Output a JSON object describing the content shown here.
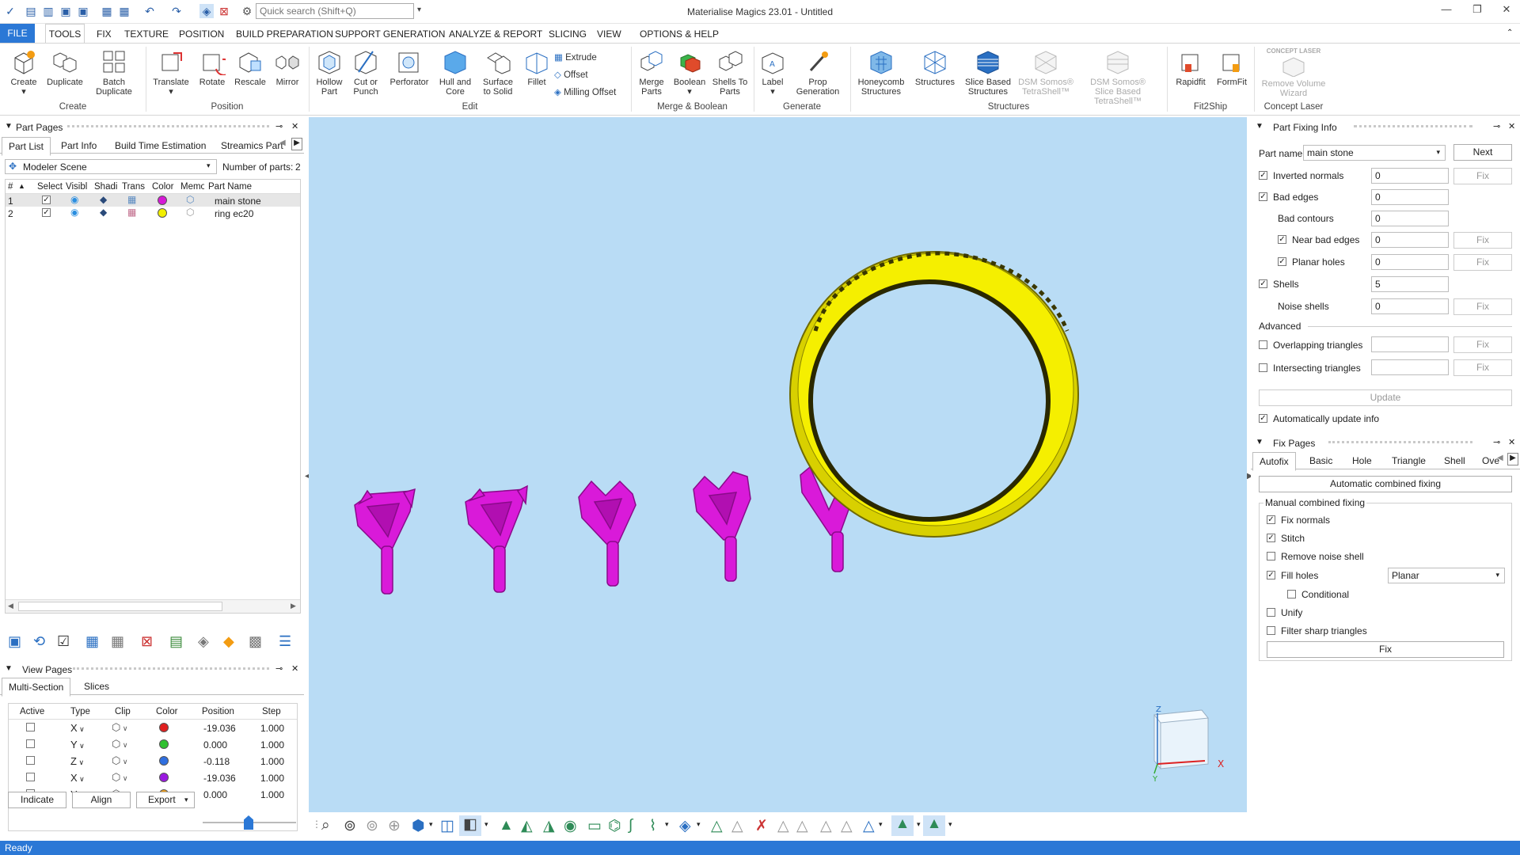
{
  "window": {
    "title": "Materialise Magics 23.01 - Untitled",
    "search_placeholder": "Quick search (Shift+Q)"
  },
  "menu": [
    "FILE",
    "TOOLS",
    "FIX",
    "TEXTURE",
    "POSITION",
    "BUILD PREPARATION",
    "SUPPORT GENERATION",
    "ANALYZE & REPORT",
    "SLICING",
    "VIEW",
    "OPTIONS & HELP"
  ],
  "ribbon": {
    "create": [
      "Create",
      "Duplicate",
      "Batch Duplicate"
    ],
    "create_group": "Create",
    "position": [
      "Translate",
      "Rotate",
      "Rescale",
      "Mirror"
    ],
    "position_group": "Position",
    "edit": [
      "Hollow Part",
      "Cut or Punch",
      "Perforator",
      "Hull and Core",
      "Surface to Solid",
      "Fillet"
    ],
    "edit_small": [
      "Extrude",
      "Offset",
      "Milling Offset"
    ],
    "edit_group": "Edit",
    "merge": [
      "Merge Parts",
      "Boolean",
      "Shells To Parts"
    ],
    "merge_group": "Merge & Boolean",
    "generate": [
      "Label",
      "Prop Generation"
    ],
    "generate_group": "Generate",
    "structures": [
      "Honeycomb Structures",
      "Structures",
      "Slice Based Structures",
      "DSM Somos® TetraShell™",
      "DSM Somos® Slice Based TetraShell™"
    ],
    "structures_group": "Structures",
    "fit2ship": [
      "Rapidfit",
      "FormFit"
    ],
    "fit2ship_group": "Fit2Ship",
    "laser": [
      "CONCEPT LASER",
      "Remove Volume Wizard"
    ],
    "laser_group": "Concept Laser"
  },
  "part_pages": {
    "title": "Part Pages",
    "tabs": [
      "Part List",
      "Part Info",
      "Build Time Estimation",
      "Streamics Part"
    ],
    "scene": "Modeler Scene",
    "num_parts_label": "Number of parts:",
    "num_parts": "2",
    "columns": [
      "#",
      "Select",
      "Visibl",
      "Shadi",
      "Trans",
      "Color",
      "Memo",
      "Part Name"
    ],
    "rows": [
      {
        "num": "1",
        "name": "main stone",
        "color": "#d61ad6"
      },
      {
        "num": "2",
        "name": "ring ec20",
        "color": "#f2ef00"
      }
    ]
  },
  "view_pages": {
    "title": "View Pages",
    "tabs": [
      "Multi-Section",
      "Slices"
    ],
    "columns": [
      "Active",
      "Type",
      "Clip",
      "Color",
      "Position",
      "Step"
    ],
    "rows": [
      {
        "type": "X",
        "color": "#e02020",
        "position": "-19.036",
        "step": "1.000"
      },
      {
        "type": "Y",
        "color": "#30c030",
        "position": "0.000",
        "step": "1.000"
      },
      {
        "type": "Z",
        "color": "#2f6fe0",
        "position": "-0.118",
        "step": "1.000"
      },
      {
        "type": "X",
        "color": "#9a1ae0",
        "position": "-19.036",
        "step": "1.000"
      },
      {
        "type": "Y",
        "color": "#f0a020",
        "position": "0.000",
        "step": "1.000"
      }
    ],
    "buttons": [
      "Indicate",
      "Align",
      "Export"
    ]
  },
  "part_fixing": {
    "title": "Part Fixing Info",
    "part_name_label": "Part name",
    "part_name": "main stone",
    "next": "Next",
    "fix": "Fix",
    "items": [
      {
        "label": "Inverted normals",
        "value": "0"
      },
      {
        "label": "Bad edges",
        "value": "0"
      },
      {
        "label": "Bad contours",
        "value": "0"
      },
      {
        "label": "Near bad edges",
        "value": "0"
      },
      {
        "label": "Planar holes",
        "value": "0"
      },
      {
        "label": "Shells",
        "value": "5"
      },
      {
        "label": "Noise shells",
        "value": "0"
      }
    ],
    "advanced": "Advanced",
    "overlapping": "Overlapping triangles",
    "intersecting": "Intersecting triangles",
    "update": "Update",
    "auto_update": "Automatically update info"
  },
  "fix_pages": {
    "title": "Fix Pages",
    "tabs": [
      "Autofix",
      "Basic",
      "Hole",
      "Triangle",
      "Shell",
      "Over"
    ],
    "auto_combined": "Automatic combined fixing",
    "manual_label": "Manual combined fixing",
    "options": [
      "Fix normals",
      "Stitch",
      "Remove noise shell",
      "Fill holes",
      "Conditional",
      "Unify",
      "Filter sharp triangles"
    ],
    "fill_mode": "Planar",
    "fix": "Fix"
  },
  "status": "Ready"
}
